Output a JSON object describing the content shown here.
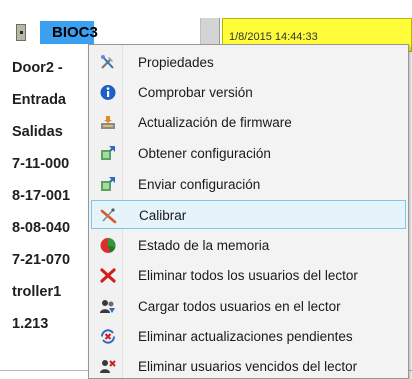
{
  "device": {
    "name": "BIOC3",
    "datetime": "1/8/2015 14:44:33"
  },
  "rows": [
    "Door2 -",
    "Entrada",
    "Salidas",
    "7-11-000",
    "8-17-001",
    "8-08-040",
    "7-21-070",
    "troller1",
    "1.213"
  ],
  "context_menu": {
    "items": [
      {
        "label": "Propiedades",
        "icon": "tools-icon"
      },
      {
        "label": "Comprobar versión",
        "icon": "info-icon"
      },
      {
        "label": "Actualización de firmware",
        "icon": "firmware-update-icon"
      },
      {
        "label": "Obtener configuración",
        "icon": "get-config-icon"
      },
      {
        "label": "Enviar configuración",
        "icon": "send-config-icon"
      },
      {
        "label": "Calibrar",
        "icon": "calibrate-icon",
        "highlighted": true
      },
      {
        "label": "Estado de la memoria",
        "icon": "memory-pie-icon"
      },
      {
        "label": "Eliminar todos los usuarios del lector",
        "icon": "delete-users-icon"
      },
      {
        "label": "Cargar todos usuarios en el lector",
        "icon": "load-users-icon"
      },
      {
        "label": "Eliminar actualizaciones pendientes",
        "icon": "remove-updates-icon"
      },
      {
        "label": "Eliminar usuarios vencidos del lector",
        "icon": "expired-users-icon"
      }
    ]
  },
  "colors": {
    "device_name_bg": "#3ca0f0",
    "datetime_bg": "#fffc3a",
    "menu_highlight_bg": "#e5f3fb",
    "menu_highlight_border": "#7dc6ec"
  }
}
